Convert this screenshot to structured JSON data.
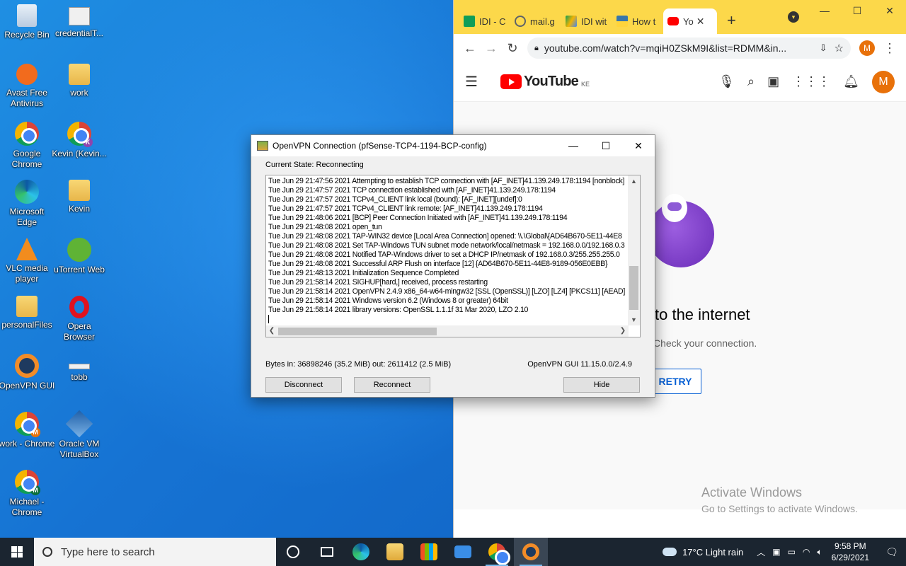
{
  "desktop": {
    "icons": [
      {
        "label": "Recycle Bin",
        "icon": "recycle-bin-icon"
      },
      {
        "label": "credentialT...",
        "icon": "file-icon"
      },
      {
        "label": "Avast Free Antivirus",
        "icon": "avast-icon"
      },
      {
        "label": "work",
        "icon": "folder-icon"
      },
      {
        "label": "Google Chrome",
        "icon": "chrome-icon"
      },
      {
        "label": "Kevin (Kevin...",
        "icon": "chrome-profile-icon"
      },
      {
        "label": "Microsoft Edge",
        "icon": "edge-icon"
      },
      {
        "label": "Kevin",
        "icon": "folder-icon"
      },
      {
        "label": "VLC media player",
        "icon": "vlc-icon"
      },
      {
        "label": "uTorrent Web",
        "icon": "utorrent-icon"
      },
      {
        "label": "personalFiles",
        "icon": "folder-icon"
      },
      {
        "label": "Opera Browser",
        "icon": "opera-icon"
      },
      {
        "label": "OpenVPN GUI",
        "icon": "openvpn-icon"
      },
      {
        "label": "tobb",
        "icon": "file-icon"
      },
      {
        "label": "work - Chrome",
        "icon": "chrome-profile-icon"
      },
      {
        "label": "Oracle VM VirtualBox",
        "icon": "virtualbox-icon"
      },
      {
        "label": "Michael - Chrome",
        "icon": "chrome-profile-icon"
      }
    ]
  },
  "browser": {
    "tabs": [
      {
        "label": "IDI - C",
        "favicon_color": "#0f9d58"
      },
      {
        "label": "mail.g",
        "favicon_color": "#5f6368"
      },
      {
        "label": "IDI wit",
        "favicon_color": "#f4b400"
      },
      {
        "label": "How t",
        "favicon_color": "#3776ab"
      },
      {
        "label": "Yo",
        "favicon_color": "#ff0000"
      }
    ],
    "new_tab_symbol": "+",
    "url": "youtube.com/watch?v=mqiH0ZSkM9I&list=RDMM&in...",
    "profile_initial": "M",
    "accent": "#fcd84a"
  },
  "youtube": {
    "logo_text": "YouTube",
    "country": "KE",
    "avatar_initial": "M",
    "offline_title": "to the internet",
    "offline_sub": "Check your connection.",
    "retry_label": "RETRY"
  },
  "watermark": {
    "line1": "Activate Windows",
    "line2": "Go to Settings to activate Windows."
  },
  "vpn": {
    "title": "OpenVPN Connection (pfSense-TCP4-1194-BCP-config)",
    "state": "Current State: Reconnecting",
    "log": [
      "Tue Jun 29 21:47:56 2021 Attempting to establish TCP connection with [AF_INET]41.139.249.178:1194 [nonblock]",
      "Tue Jun 29 21:47:57 2021 TCP connection established with [AF_INET]41.139.249.178:1194",
      "Tue Jun 29 21:47:57 2021 TCPv4_CLIENT link local (bound): [AF_INET][undef]:0",
      "Tue Jun 29 21:47:57 2021 TCPv4_CLIENT link remote: [AF_INET]41.139.249.178:1194",
      "Tue Jun 29 21:48:06 2021 [BCP] Peer Connection Initiated with [AF_INET]41.139.249.178:1194",
      "Tue Jun 29 21:48:08 2021 open_tun",
      "Tue Jun 29 21:48:08 2021 TAP-WIN32 device [Local Area Connection] opened: \\\\.\\Global\\{AD64B670-5E11-44E8",
      "Tue Jun 29 21:48:08 2021 Set TAP-Windows TUN subnet mode network/local/netmask = 192.168.0.0/192.168.0.3",
      "Tue Jun 29 21:48:08 2021 Notified TAP-Windows driver to set a DHCP IP/netmask of 192.168.0.3/255.255.255.0",
      "Tue Jun 29 21:48:08 2021 Successful ARP Flush on interface [12] {AD64B670-5E11-44E8-9189-056E0EBB}",
      "Tue Jun 29 21:48:13 2021 Initialization Sequence Completed",
      "Tue Jun 29 21:58:14 2021 SIGHUP[hard,] received, process restarting",
      "Tue Jun 29 21:58:14 2021 OpenVPN 2.4.9 x86_64-w64-mingw32 [SSL (OpenSSL)] [LZO] [LZ4] [PKCS11] [AEAD]",
      "Tue Jun 29 21:58:14 2021 Windows version 6.2 (Windows 8 or greater) 64bit",
      "Tue Jun 29 21:58:14 2021 library versions: OpenSSL 1.1.1f  31 Mar 2020, LZO 2.10"
    ],
    "bytes": "Bytes in: 36898246 (35.2 MiB)  out: 2611412 (2.5 MiB)",
    "version": "OpenVPN GUI 11.15.0.0/2.4.9",
    "btn_disconnect": "Disconnect",
    "btn_reconnect": "Reconnect",
    "btn_hide": "Hide"
  },
  "taskbar": {
    "search_placeholder": "Type here to search",
    "apps": [
      {
        "name": "cortana-icon",
        "color": "#ffffff"
      },
      {
        "name": "task-view-icon",
        "color": "#ffffff"
      },
      {
        "name": "edge-icon",
        "color": "#1fa2d8"
      },
      {
        "name": "file-explorer-icon",
        "color": "#f8c846"
      },
      {
        "name": "store-icon",
        "color": "#f5a623"
      },
      {
        "name": "mail-icon",
        "color": "#3a8ee6"
      },
      {
        "name": "chrome-icon",
        "color": "#db4437"
      },
      {
        "name": "openvpn-icon",
        "color": "#f28c28"
      }
    ],
    "weather": "17°C  Light rain",
    "time": "9:58 PM",
    "date": "6/29/2021"
  }
}
